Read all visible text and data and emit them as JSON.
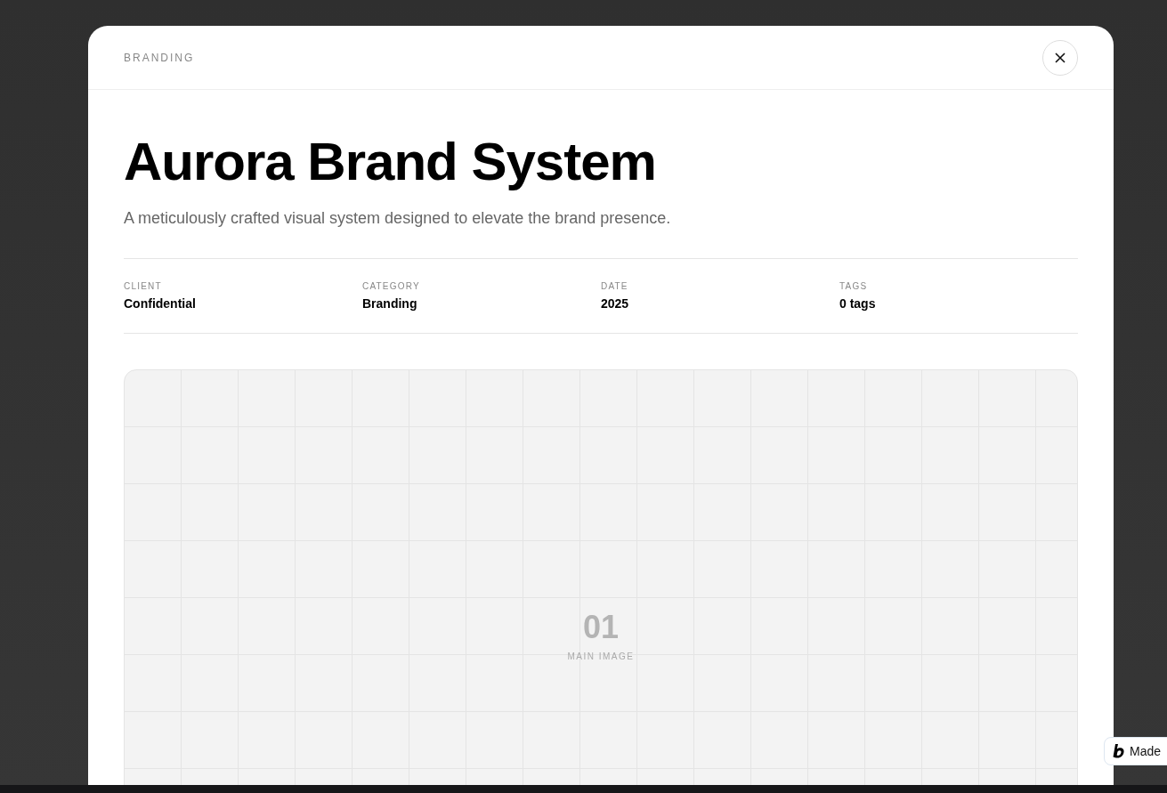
{
  "modal": {
    "eyebrow": "BRANDING",
    "title": "Aurora Brand System",
    "subtitle": "A meticulously crafted visual system designed to elevate the brand presence.",
    "meta": [
      {
        "label": "CLIENT",
        "value": "Confidential"
      },
      {
        "label": "CATEGORY",
        "value": "Branding"
      },
      {
        "label": "DATE",
        "value": "2025"
      },
      {
        "label": "TAGS",
        "value": "0 tags"
      }
    ],
    "media": {
      "number": "01",
      "caption": "MAIN IMAGE"
    }
  },
  "badge": {
    "text": "Made"
  }
}
